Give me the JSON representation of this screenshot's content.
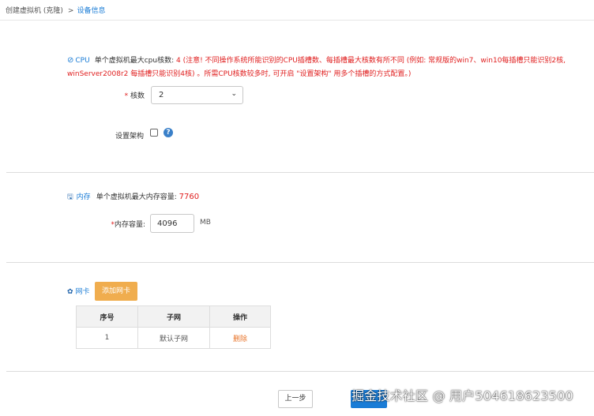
{
  "breadcrumb": {
    "parent": "创建虚拟机 (克隆)",
    "separator": ">",
    "current": "设备信息"
  },
  "cpu": {
    "icon": "check-circle-icon",
    "title": "CPU",
    "max_label": "单个虚拟机最大cpu核数:",
    "max_note": "4 (注意! 不同操作系统所能识别的CPU插槽数、每插槽最大核数有所不同 (例如: 常规版的win7、win10每插槽只能识别2核, winServer2008r2 每插槽只能识别4核) 。所需CPU核数较多时, 可开启 \"设置架构\" 用多个插槽的方式配置。)",
    "cores_label": "核数",
    "cores_value": "2",
    "arch_label": "设置架构",
    "arch_checked": false,
    "help_icon": "question-circle-icon"
  },
  "memory": {
    "icon": "save-icon",
    "title": "内存",
    "max_label": "单个虚拟机最大内存容量:",
    "max_value": "7760",
    "capacity_label": "内存容量:",
    "capacity_value": "4096",
    "unit": "MB"
  },
  "network": {
    "icon": "network-icon",
    "title": "网卡",
    "add_button": "添加网卡",
    "columns": [
      "序号",
      "子网",
      "操作"
    ],
    "rows": [
      {
        "index": "1",
        "subnet": "默认子网",
        "action": "删除"
      }
    ]
  },
  "footer": {
    "prev_button": "上一步",
    "watermark": "掘金技术社区 @ 用户504618623500"
  },
  "colors": {
    "accent": "#1a7cd6",
    "warning_text": "#e02020",
    "add_button": "#f0ad4e",
    "delete_link": "#e8742a"
  }
}
